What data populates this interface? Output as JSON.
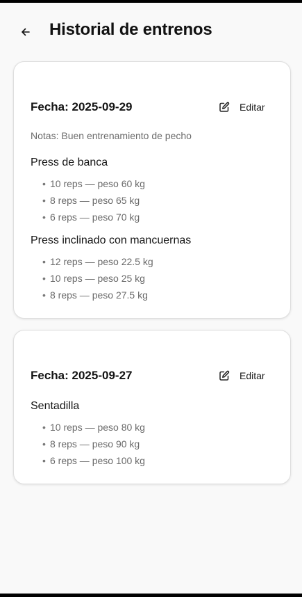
{
  "header": {
    "title": "Historial de entrenos",
    "back_icon": "arrow-left-icon"
  },
  "workouts": [
    {
      "date_label": "Fecha: 2025-09-29",
      "edit_label": "Editar",
      "notes": "Notas: Buen entrenamiento de pecho",
      "exercises": [
        {
          "name": "Press de banca",
          "sets": [
            "10 reps — peso 60 kg",
            "8 reps — peso 65 kg",
            "6 reps — peso 70 kg"
          ]
        },
        {
          "name": "Press inclinado con mancuernas",
          "sets": [
            "12 reps — peso 22.5 kg",
            "10 reps — peso 25 kg",
            "8 reps — peso 27.5 kg"
          ]
        }
      ]
    },
    {
      "date_label": "Fecha: 2025-09-27",
      "edit_label": "Editar",
      "exercises": [
        {
          "name": "Sentadilla",
          "sets": [
            "10 reps — peso 80 kg",
            "8 reps — peso 90 kg",
            "6 reps — peso 100 kg"
          ]
        }
      ]
    }
  ],
  "bullet": "•"
}
